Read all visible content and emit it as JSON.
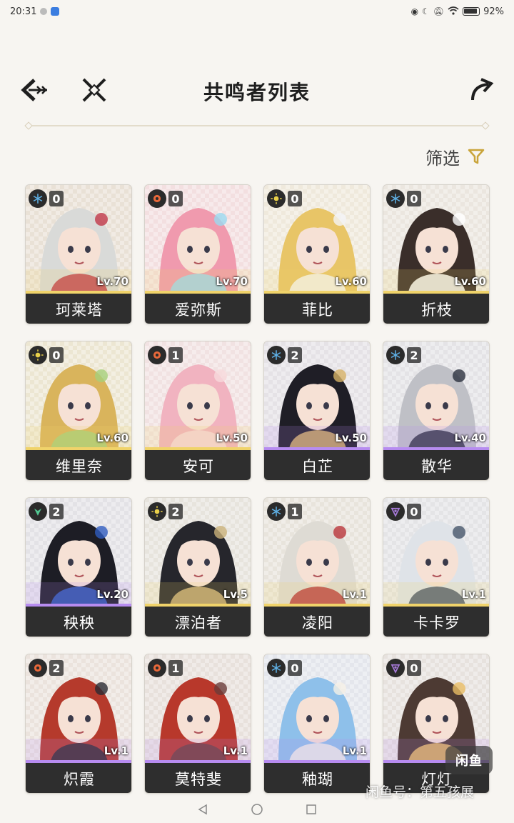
{
  "status_bar": {
    "time": "20:31",
    "battery": "92%"
  },
  "header": {
    "title": "共鸣者列表"
  },
  "filter": {
    "label": "筛选"
  },
  "colors": {
    "accent_gold": "#c9a43a",
    "name_bar": "#2e2e2e",
    "rarity_5": "#f0d36a",
    "rarity_4": "#b78cf0"
  },
  "characters": [
    {
      "name": "珂莱塔",
      "level": "Lv.70",
      "sequence": "0",
      "element": "glacio-icon",
      "element_color": "#5fb2e8",
      "rarity_color": "#f0d36a",
      "bg": "#e9e1d6",
      "hair": "#d9dad8",
      "accent": "#c0384a"
    },
    {
      "name": "爱弥斯",
      "level": "Lv.70",
      "sequence": "0",
      "element": "fusion-icon",
      "element_color": "#e8683a",
      "rarity_color": "#f0d36a",
      "bg": "#f3dfe0",
      "hair": "#f09aae",
      "accent": "#9ad9f0"
    },
    {
      "name": "菲比",
      "level": "Lv.60",
      "sequence": "0",
      "element": "spectro-icon",
      "element_color": "#e9d04a",
      "rarity_color": "#f0d36a",
      "bg": "#efe9dc",
      "hair": "#e8c567",
      "accent": "#f4f4f6"
    },
    {
      "name": "折枝",
      "level": "Lv.60",
      "sequence": "0",
      "element": "glacio-icon",
      "element_color": "#5fb2e8",
      "rarity_color": "#f0d36a",
      "bg": "#ebe6df",
      "hair": "#3a2e2a",
      "accent": "#ffffff"
    },
    {
      "name": "维里奈",
      "level": "Lv.60",
      "sequence": "0",
      "element": "spectro-icon",
      "element_color": "#e9d04a",
      "rarity_color": "#f0d36a",
      "bg": "#ece6d2",
      "hair": "#d9b45c",
      "accent": "#a6cf7a"
    },
    {
      "name": "安可",
      "level": "Lv.50",
      "sequence": "1",
      "element": "fusion-icon",
      "element_color": "#e8683a",
      "rarity_color": "#f0d36a",
      "bg": "#f1e2e2",
      "hair": "#f1b3c0",
      "accent": "#f7d9dc"
    },
    {
      "name": "白芷",
      "level": "Lv.50",
      "sequence": "2",
      "element": "glacio-icon",
      "element_color": "#5fb2e8",
      "rarity_color": "#b78cf0",
      "bg": "#e5e2e6",
      "hair": "#1f1e26",
      "accent": "#d6b266"
    },
    {
      "name": "散华",
      "level": "Lv.40",
      "sequence": "2",
      "element": "glacio-icon",
      "element_color": "#5fb2e8",
      "rarity_color": "#b78cf0",
      "bg": "#e4e3e6",
      "hair": "#bfc0c6",
      "accent": "#2b2f3d"
    },
    {
      "name": "秧秧",
      "level": "Lv.20",
      "sequence": "2",
      "element": "aero-icon",
      "element_color": "#52c792",
      "rarity_color": "#b78cf0",
      "bg": "#e3e2e6",
      "hair": "#1d1d25",
      "accent": "#2f5dbf"
    },
    {
      "name": "漂泊者",
      "level": "Lv.5",
      "sequence": "2",
      "element": "spectro-icon",
      "element_color": "#e9d04a",
      "rarity_color": "#f0d36a",
      "bg": "#e7e4dd",
      "hair": "#26262c",
      "accent": "#cbb27a"
    },
    {
      "name": "凌阳",
      "level": "Lv.1",
      "sequence": "1",
      "element": "glacio-icon",
      "element_color": "#5fb2e8",
      "rarity_color": "#f0d36a",
      "bg": "#e8e4dc",
      "hair": "#dedbd4",
      "accent": "#b9363b"
    },
    {
      "name": "卡卡罗",
      "level": "Lv.1",
      "sequence": "0",
      "element": "electro-icon",
      "element_color": "#a77ad9",
      "rarity_color": "#f0d36a",
      "bg": "#e4e4e6",
      "hair": "#dfe3e8",
      "accent": "#46556a"
    },
    {
      "name": "炽霞",
      "level": "Lv.1",
      "sequence": "2",
      "element": "fusion-icon",
      "element_color": "#e8683a",
      "rarity_color": "#b78cf0",
      "bg": "#ebe3dd",
      "hair": "#b53a2c",
      "accent": "#2b2b33"
    },
    {
      "name": "莫特斐",
      "level": "Lv.1",
      "sequence": "1",
      "element": "fusion-icon",
      "element_color": "#e8683a",
      "rarity_color": "#b78cf0",
      "bg": "#e8e1dc",
      "hair": "#b8382b",
      "accent": "#6a3c3a"
    },
    {
      "name": "釉瑚",
      "level": "Lv.1",
      "sequence": "0",
      "element": "glacio-icon",
      "element_color": "#5fb2e8",
      "rarity_color": "#b78cf0",
      "bg": "#e4e6ec",
      "hair": "#8ec0ea",
      "accent": "#f5f0e6"
    },
    {
      "name": "灯灯",
      "level": "",
      "sequence": "0",
      "element": "electro-icon",
      "element_color": "#a77ad9",
      "rarity_color": "#b78cf0",
      "bg": "#e7e2de",
      "hair": "#4d3a33",
      "accent": "#e9bd64"
    }
  ],
  "watermark": {
    "badge": "闲鱼",
    "text": "闲鱼号：第五孩展"
  }
}
